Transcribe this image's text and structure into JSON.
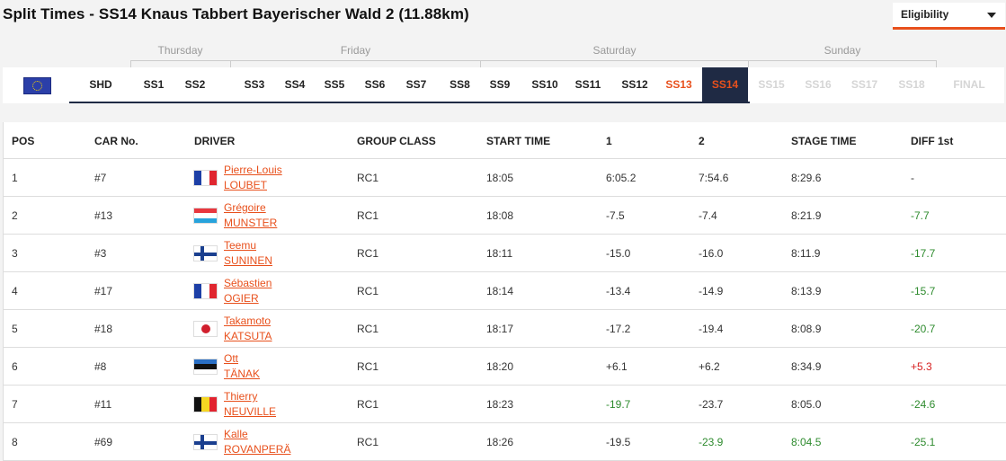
{
  "title": "Split Times - SS14 Knaus Tabbert Bayerischer Wald 2 (11.88km)",
  "eligibility": {
    "label": "Eligibility"
  },
  "days": [
    "Thursday",
    "Friday",
    "Saturday",
    "Sunday"
  ],
  "stages": [
    {
      "label": "SHD",
      "state": "normal"
    },
    {
      "label": "SS1",
      "state": "normal"
    },
    {
      "label": "SS2",
      "state": "normal"
    },
    {
      "label": "SS3",
      "state": "normal"
    },
    {
      "label": "SS4",
      "state": "normal"
    },
    {
      "label": "SS5",
      "state": "normal"
    },
    {
      "label": "SS6",
      "state": "normal"
    },
    {
      "label": "SS7",
      "state": "normal"
    },
    {
      "label": "SS8",
      "state": "normal"
    },
    {
      "label": "SS9",
      "state": "normal"
    },
    {
      "label": "SS10",
      "state": "normal"
    },
    {
      "label": "SS11",
      "state": "normal"
    },
    {
      "label": "SS12",
      "state": "normal"
    },
    {
      "label": "SS13",
      "state": "highlight"
    },
    {
      "label": "SS14",
      "state": "current"
    },
    {
      "label": "SS15",
      "state": "disabled"
    },
    {
      "label": "SS16",
      "state": "disabled"
    },
    {
      "label": "SS17",
      "state": "disabled"
    },
    {
      "label": "SS18",
      "state": "disabled"
    },
    {
      "label": "FINAL",
      "state": "disabled"
    }
  ],
  "columns": [
    "POS",
    "CAR No.",
    "DRIVER",
    "GROUP CLASS",
    "START TIME",
    "1",
    "2",
    "STAGE TIME",
    "DIFF 1st"
  ],
  "rows": [
    {
      "pos": "1",
      "car": "#7",
      "first": "Pierre-Louis",
      "last": "LOUBET",
      "flag": "fr",
      "group": "RC1",
      "start": "18:05",
      "s1": "6:05.2",
      "s2": "7:54.6",
      "stage": "8:29.6",
      "diff": "-",
      "s2c": "",
      "stc": "",
      "dc": ""
    },
    {
      "pos": "2",
      "car": "#13",
      "first": "Grégoire",
      "last": "MUNSTER",
      "flag": "lu",
      "group": "RC1",
      "start": "18:08",
      "s1": "-7.5",
      "s2": "-7.4",
      "stage": "8:21.9",
      "diff": "-7.7",
      "s2c": "",
      "stc": "",
      "dc": "green"
    },
    {
      "pos": "3",
      "car": "#3",
      "first": "Teemu",
      "last": "SUNINEN",
      "flag": "fi",
      "group": "RC1",
      "start": "18:11",
      "s1": "-15.0",
      "s2": "-16.0",
      "stage": "8:11.9",
      "diff": "-17.7",
      "s2c": "",
      "stc": "",
      "dc": "green"
    },
    {
      "pos": "4",
      "car": "#17",
      "first": "Sébastien",
      "last": "OGIER",
      "flag": "fr",
      "group": "RC1",
      "start": "18:14",
      "s1": "-13.4",
      "s2": "-14.9",
      "stage": "8:13.9",
      "diff": "-15.7",
      "s2c": "",
      "stc": "",
      "dc": "green"
    },
    {
      "pos": "5",
      "car": "#18",
      "first": "Takamoto",
      "last": "KATSUTA",
      "flag": "jp",
      "group": "RC1",
      "start": "18:17",
      "s1": "-17.2",
      "s2": "-19.4",
      "stage": "8:08.9",
      "diff": "-20.7",
      "s2c": "",
      "stc": "",
      "dc": "green"
    },
    {
      "pos": "6",
      "car": "#8",
      "first": "Ott",
      "last": "TÄNAK",
      "flag": "ee",
      "group": "RC1",
      "start": "18:20",
      "s1": "+6.1",
      "s2": "+6.2",
      "stage": "8:34.9",
      "diff": "+5.3",
      "s2c": "",
      "stc": "",
      "dc": "red"
    },
    {
      "pos": "7",
      "car": "#11",
      "first": "Thierry",
      "last": "NEUVILLE",
      "flag": "be",
      "group": "RC1",
      "start": "18:23",
      "s1": "-19.7",
      "s2": "-23.7",
      "stage": "8:05.0",
      "diff": "-24.6",
      "s1c": "green",
      "s2c": "",
      "stc": "",
      "dc": "green"
    },
    {
      "pos": "8",
      "car": "#69",
      "first": "Kalle",
      "last": "ROVANPERÄ",
      "flag": "fi",
      "group": "RC1",
      "start": "18:26",
      "s1": "-19.5",
      "s2": "-23.9",
      "stage": "8:04.5",
      "diff": "-25.1",
      "s2c": "green",
      "stc": "green",
      "dc": "green"
    }
  ]
}
